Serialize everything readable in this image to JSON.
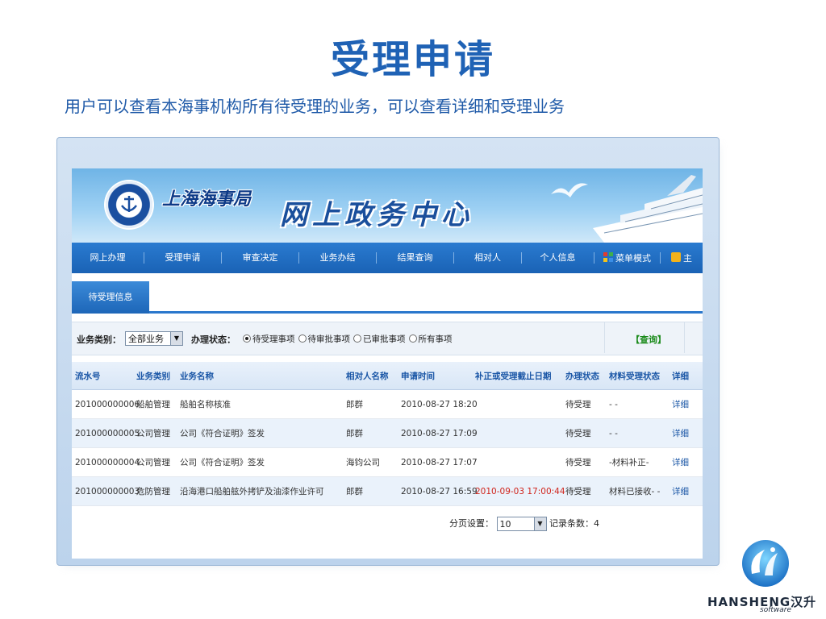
{
  "slide": {
    "title": "受理申请",
    "subtitle": "用户可以查看本海事机构所有待受理的业务，可以查看详细和受理业务"
  },
  "banner": {
    "org_name": "上海海事局",
    "portal_name": "网上政务中心"
  },
  "nav": {
    "items": [
      {
        "label": "网上办理",
        "icon": ""
      },
      {
        "label": "受理申请",
        "icon": ""
      },
      {
        "label": "审查决定",
        "icon": ""
      },
      {
        "label": "业务办结",
        "icon": ""
      },
      {
        "label": "结果查询",
        "icon": ""
      },
      {
        "label": "相对人",
        "icon": ""
      },
      {
        "label": "个人信息",
        "icon": ""
      },
      {
        "label": "菜单模式",
        "icon": "menu-icon"
      },
      {
        "label": "主",
        "icon": "home-icon"
      }
    ]
  },
  "tabs": [
    {
      "label": "待受理信息",
      "active": true
    }
  ],
  "filter": {
    "category_label": "业务类别：",
    "category_value": "全部业务",
    "status_label": "办理状态：",
    "status_options": [
      {
        "label": "待受理事项",
        "checked": true
      },
      {
        "label": "待审批事项",
        "checked": false
      },
      {
        "label": "已审批事项",
        "checked": false
      },
      {
        "label": "所有事项",
        "checked": false
      }
    ],
    "query_label": "【查询】"
  },
  "table": {
    "headers": [
      "流水号",
      "业务类别",
      "业务名称",
      "相对人名称",
      "申请时间",
      "补正或受理截止日期",
      "办理状态",
      "材料受理状态",
      "详细"
    ],
    "rows": [
      [
        "201000000006",
        "船舶管理",
        "船舶名称核准",
        "郎群",
        "2010-08-27 18:20",
        "",
        "待受理",
        "- -",
        "详细"
      ],
      [
        "201000000005",
        "公司管理",
        "公司《符合证明》签发",
        "郎群",
        "2010-08-27 17:09",
        "",
        "待受理",
        "- -",
        "详细"
      ],
      [
        "201000000004",
        "公司管理",
        "公司《符合证明》签发",
        "海钧公司",
        "2010-08-27 17:07",
        "",
        "待受理",
        "-材料补正-",
        "详细"
      ],
      [
        "201000000003",
        "危防管理",
        "沿海港口船舶舷外拷铲及油漆作业许可",
        "郎群",
        "2010-08-27 16:59",
        "2010-09-03 17:00:44",
        "待受理",
        "材料已接收- -",
        "详细"
      ]
    ]
  },
  "pager": {
    "page_size_label": "分页设置：",
    "page_size_value": "10",
    "record_count_label": "记录条数：4"
  },
  "logo": {
    "brand": "HANSHENG汉升",
    "sub": "software"
  },
  "colors": {
    "title": "#1f62b5",
    "nav_bar": "#1a62b5",
    "deadline_text": "#d0241b",
    "query_text": "#1a8a1a"
  }
}
